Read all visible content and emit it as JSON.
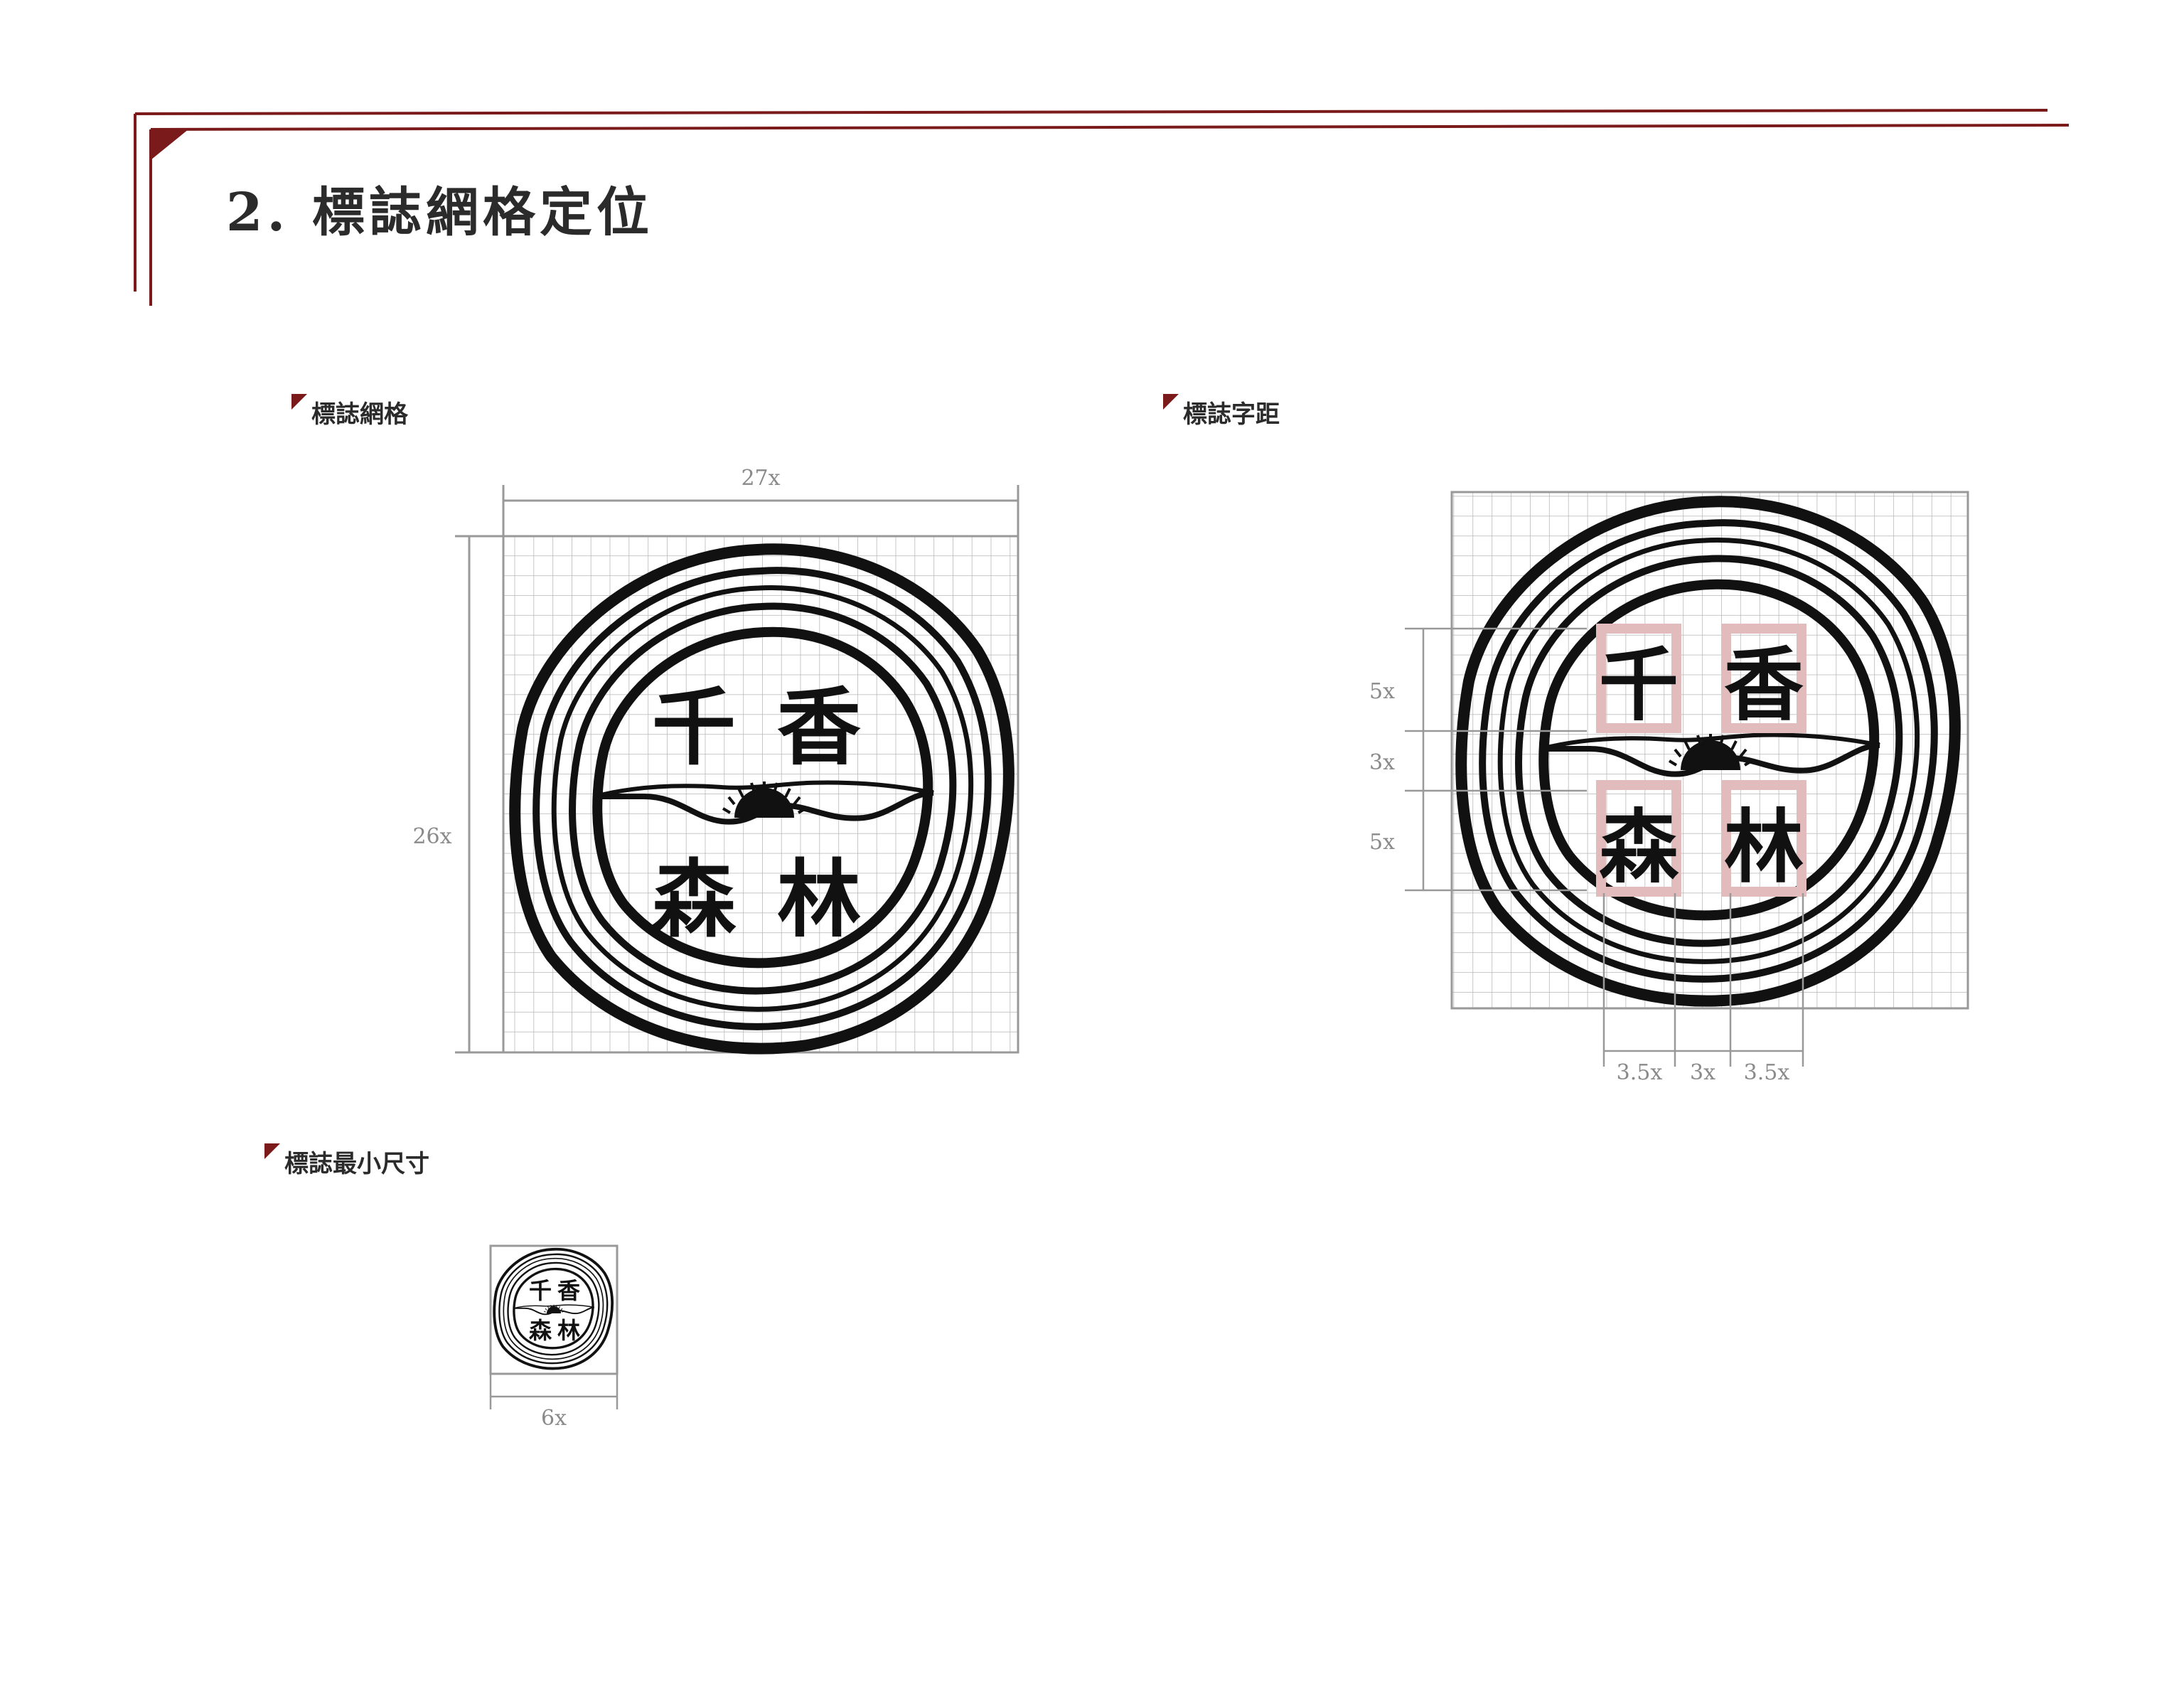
{
  "header": {
    "title": "2. 標誌網格定位"
  },
  "sections": {
    "grid": {
      "label": "標誌網格",
      "width_label": "27x",
      "height_label": "26x"
    },
    "spacing": {
      "label": "標誌字距",
      "vertical_labels": [
        "5x",
        "3x",
        "5x"
      ],
      "horizontal_labels": [
        "3.5x",
        "3x",
        "3.5x"
      ]
    },
    "min_size": {
      "label": "標誌最小尺寸",
      "width_label": "6x"
    }
  },
  "logo": {
    "chars": [
      "千",
      "香",
      "森",
      "林"
    ]
  },
  "colors": {
    "accent": "#7a1a1a",
    "grid": "#9a9a9a",
    "dim": "#8a8a8a",
    "highlight": "#e8c6c6"
  }
}
